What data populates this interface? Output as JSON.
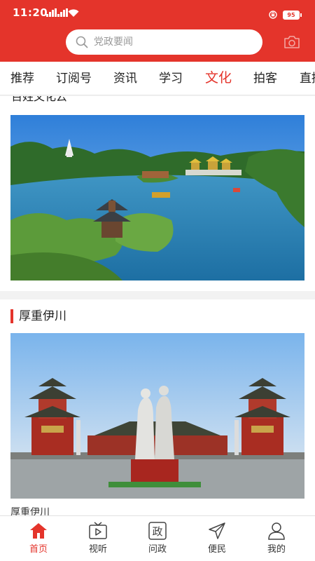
{
  "status_bar": {
    "time": "11:20",
    "battery": "95"
  },
  "search": {
    "placeholder": "党政要闻"
  },
  "tabs": [
    {
      "label": "推荐"
    },
    {
      "label": "订阅号"
    },
    {
      "label": "资讯"
    },
    {
      "label": "学习"
    },
    {
      "label": "文化",
      "active": true
    },
    {
      "label": "拍客"
    },
    {
      "label": "直播"
    }
  ],
  "feed": {
    "card1_title": "百姓文化云",
    "card2_title": "厚重伊川",
    "card2_caption": "厚重伊川"
  },
  "bottom_nav": [
    {
      "label": "首页",
      "icon": "home-icon",
      "active": true
    },
    {
      "label": "视听",
      "icon": "tv-play-icon"
    },
    {
      "label": "问政",
      "icon": "zheng-icon",
      "glyph": "政"
    },
    {
      "label": "便民",
      "icon": "paper-plane-icon"
    },
    {
      "label": "我的",
      "icon": "user-icon"
    }
  ],
  "colors": {
    "brand_red": "#e4342b",
    "tab_active": "#e4342b"
  }
}
